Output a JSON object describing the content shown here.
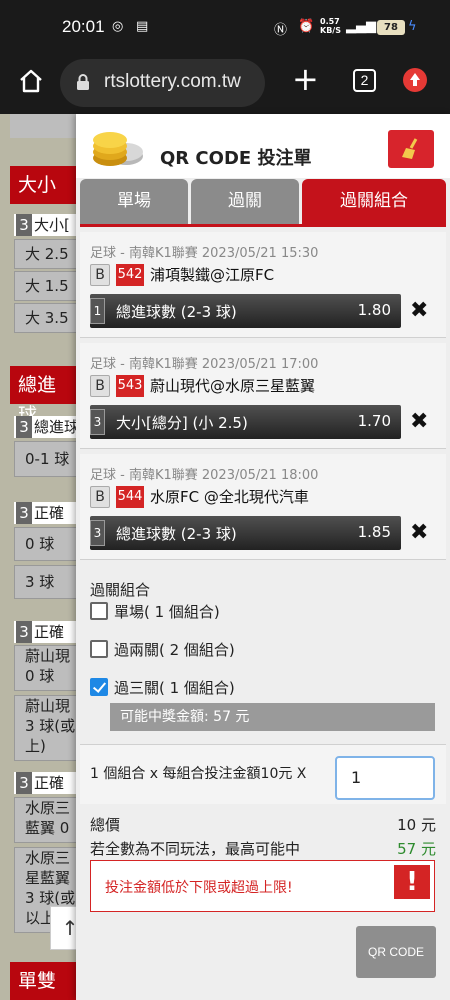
{
  "status_bar": {
    "time": "20:01",
    "net_speed": "0.57",
    "net_unit": "KB/S",
    "battery": "78"
  },
  "browser": {
    "url": "rtslottery.com.tw",
    "tab_count": "2"
  },
  "background": {
    "sections": [
      "大小",
      "總進球",
      "單雙"
    ],
    "subs": [
      "大小[",
      "總進球",
      "正確",
      "正確",
      "正確"
    ],
    "sub_nums": [
      "3",
      "3",
      "3",
      "3",
      "3"
    ],
    "options": [
      "大 2.5",
      "大 1.5",
      "大 3.5",
      "0-1 球",
      "0 球",
      "3 球",
      "蔚山現\n0 球",
      "蔚山現\n3 球(或\n上)",
      "水原三\n藍翼 0",
      "水原三\n星藍翼\n3 球(或\n以上"
    ],
    "up_arrow": "↑"
  },
  "panel": {
    "title": "QR CODE 投注單",
    "tabs": [
      "單場",
      "過關",
      "過關組合"
    ],
    "bets": [
      {
        "league": "足球 - 南韓K1聯賽 2023/05/21 15:30",
        "type": "B",
        "code": "542",
        "match": "浦項製鐵@江原FC",
        "num": "1",
        "pick": "總進球數 (2-3 球)",
        "odds": "1.80"
      },
      {
        "league": "足球 - 南韓K1聯賽 2023/05/21 17:00",
        "type": "B",
        "code": "543",
        "match": "蔚山現代@水原三星藍翼",
        "num": "3",
        "pick": "大小[總分] (小 2.5)",
        "odds": "1.70"
      },
      {
        "league": "足球 - 南韓K1聯賽 2023/05/21 18:00",
        "type": "B",
        "code": "544",
        "match": "水原FC @全北現代汽車",
        "num": "3",
        "pick": "總進球數 (2-3 球)",
        "odds": "1.85"
      }
    ],
    "delete_symbol": "✖",
    "combo_title": "過關組合",
    "combo_options": [
      {
        "label": "單場( 1 個組合)",
        "checked": false
      },
      {
        "label": "過兩關( 2 個組合)",
        "checked": false
      },
      {
        "label": "過三關( 1 個組合)",
        "checked": true
      }
    ],
    "payout": "可能中獎金額: 57 元",
    "stake_text": "1 個組合 x 每組合投注金額10元 X",
    "stake_value": "1",
    "total_label": "總價",
    "total_value": "10 元",
    "max_label": "若全數為不同玩法，最高可能中",
    "max_value": "57 元",
    "error_msg": "投注金額低於下限或超過上限!",
    "error_icon": "!",
    "qr_button": "QR CODE"
  }
}
